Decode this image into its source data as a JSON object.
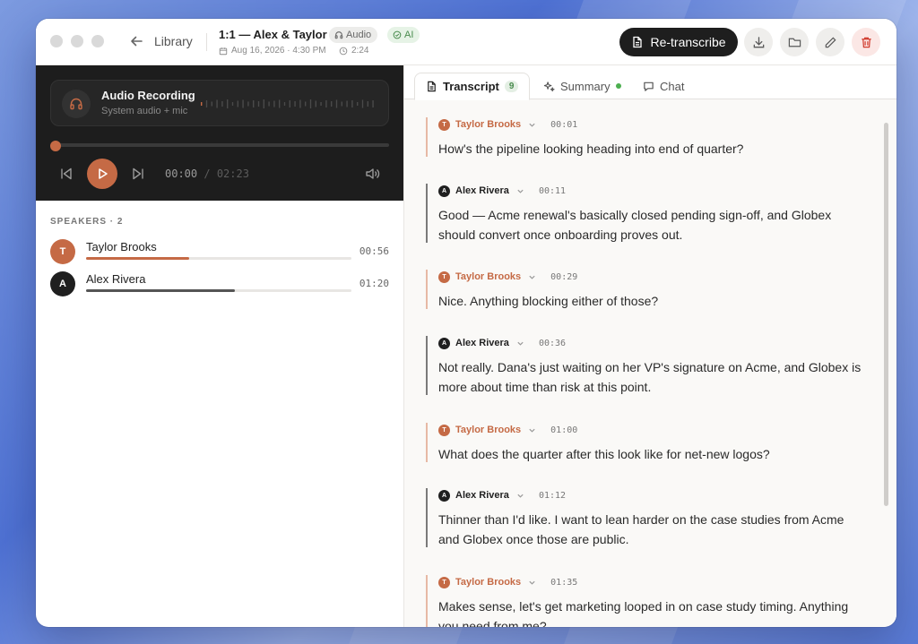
{
  "colors": {
    "accent": "#c56a45",
    "alex": "#1f1f1f",
    "danger": "#d0392b",
    "success": "#4caf50"
  },
  "header": {
    "back_label": "Library",
    "title": "1:1 — Alex & Taylor",
    "chip_audio": "Audio",
    "chip_ai": "AI",
    "date": "Aug 16, 2026 · 4:30 PM",
    "duration": "2:24",
    "retranscribe_label": "Re-transcribe",
    "icons": [
      "download-icon",
      "folder-icon",
      "pencil-icon",
      "trash-icon"
    ]
  },
  "player": {
    "title": "Audio Recording",
    "subtitle": "System audio + mic",
    "current": "00:00",
    "separator": "/",
    "total": "02:23",
    "progress": 0
  },
  "speakers": {
    "heading": "SPEAKERS · 2",
    "list": [
      {
        "initial": "T",
        "name": "Taylor Brooks",
        "duration": "00:56",
        "share": 0.39
      },
      {
        "initial": "A",
        "name": "Alex Rivera",
        "duration": "01:20",
        "share": 0.56
      }
    ]
  },
  "tabs": {
    "transcript": "Transcript",
    "transcript_count": "9",
    "summary": "Summary",
    "chat": "Chat"
  },
  "transcript": [
    {
      "speaker": "Taylor Brooks",
      "initial": "T",
      "time": "00:01",
      "text": "How's the pipeline looking heading into end of quarter?"
    },
    {
      "speaker": "Alex Rivera",
      "initial": "A",
      "time": "00:11",
      "text": "Good — Acme renewal's basically closed pending sign-off, and Globex should convert once onboarding proves out."
    },
    {
      "speaker": "Taylor Brooks",
      "initial": "T",
      "time": "00:29",
      "text": "Nice. Anything blocking either of those?"
    },
    {
      "speaker": "Alex Rivera",
      "initial": "A",
      "time": "00:36",
      "text": "Not really. Dana's just waiting on her VP's signature on Acme, and Globex is more about time than risk at this point."
    },
    {
      "speaker": "Taylor Brooks",
      "initial": "T",
      "time": "01:00",
      "text": "What does the quarter after this look like for net-new logos?"
    },
    {
      "speaker": "Alex Rivera",
      "initial": "A",
      "time": "01:12",
      "text": "Thinner than I'd like. I want to lean harder on the case studies from Acme and Globex once those are public."
    },
    {
      "speaker": "Taylor Brooks",
      "initial": "T",
      "time": "01:35",
      "text": "Makes sense, let's get marketing looped in on case study timing. Anything you need from me?"
    }
  ]
}
